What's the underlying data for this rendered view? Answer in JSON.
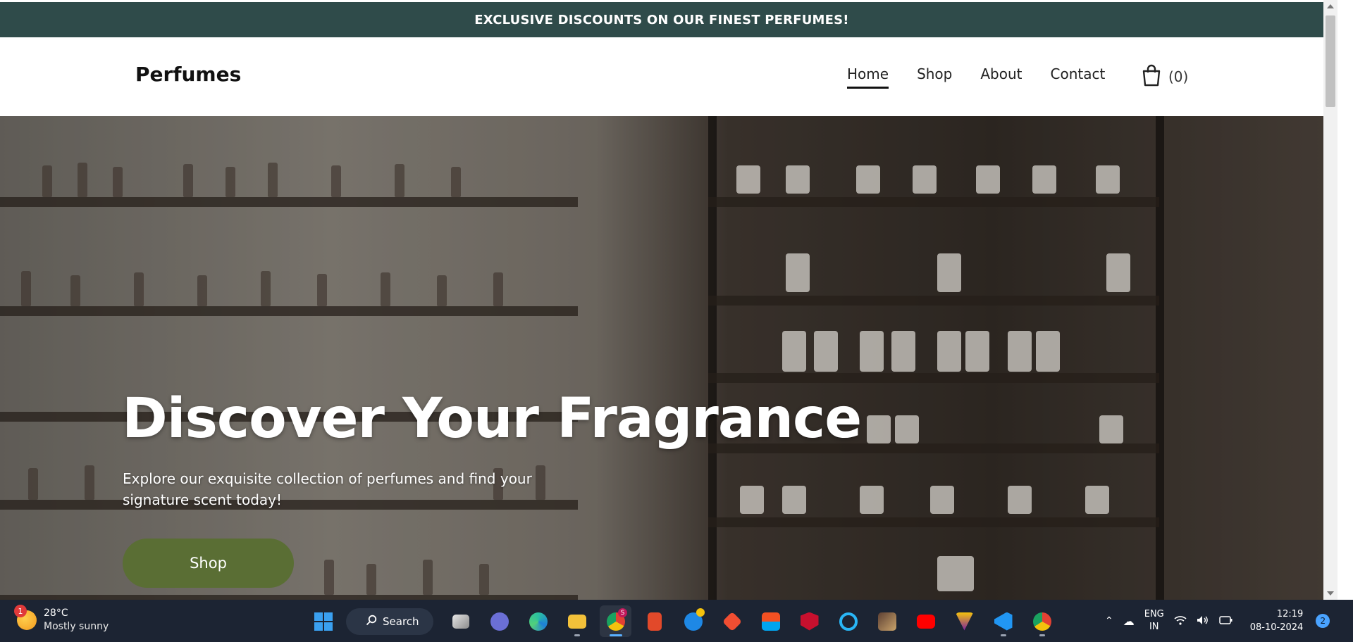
{
  "announcement": {
    "text": "EXCLUSIVE DISCOUNTS ON OUR FINEST PERFUMES!"
  },
  "header": {
    "logo": "Perfumes",
    "nav": [
      {
        "label": "Home",
        "active": true
      },
      {
        "label": "Shop",
        "active": false
      },
      {
        "label": "About",
        "active": false
      },
      {
        "label": "Contact",
        "active": false
      }
    ],
    "cart": {
      "icon": "shopping-bag-icon",
      "count": "(0)"
    }
  },
  "hero": {
    "title": "Discover Your Fragrance",
    "subtitle": "Explore our exquisite collection of perfumes and find your signature scent today!",
    "button_label": "Shop",
    "button_color": "#5a6e34"
  },
  "colors": {
    "announcement_bg": "#2f4b4a",
    "taskbar_bg": "#1c2433"
  },
  "taskbar": {
    "weather": {
      "badge": "1",
      "temp": "28°C",
      "condition": "Mostly sunny"
    },
    "search_label": "Search",
    "apps": [
      "windows-start-icon",
      "task-view-icon",
      "teams-meet-icon",
      "edge-icon",
      "file-explorer-icon",
      "chrome-icon",
      "office-icon",
      "help-icon",
      "git-icon",
      "ms-store-icon",
      "mcafee-icon",
      "cortana-icon",
      "game-icon",
      "youtube-icon",
      "winamp-icon",
      "vscode-icon",
      "chrome-icon"
    ],
    "chrome_badge": "S",
    "lang_top": "ENG",
    "lang_bottom": "IN",
    "time": "12:19",
    "date": "08-10-2024",
    "notifications": "2"
  }
}
